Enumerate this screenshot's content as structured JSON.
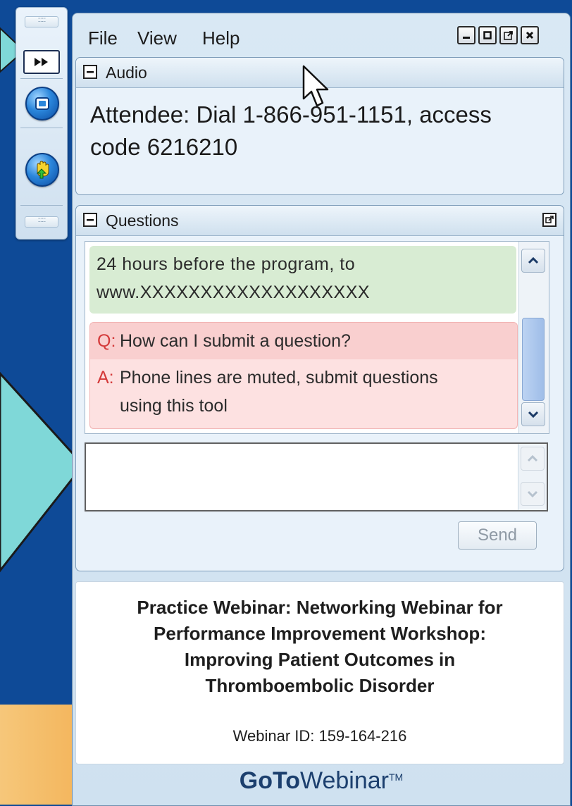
{
  "menu": {
    "file": "File",
    "view": "View",
    "help": "Help"
  },
  "window_controls": [
    "minimize",
    "restore",
    "pop-out",
    "close"
  ],
  "audio": {
    "title": "Audio",
    "line1": "Attendee: Dial 1-866-951-1151, access",
    "line2": "code 6216210"
  },
  "questions": {
    "title": "Questions",
    "answer_line1": "24 hours before the program, to",
    "answer_line2": "www.XXXXXXXXXXXXXXXXXXX",
    "q_prefix": "Q:",
    "q_text": "How can I submit a question?",
    "a_prefix": "A:",
    "a_line1": "Phone lines are muted, submit questions",
    "a_line2": "using this tool",
    "input_value": "",
    "send_label": "Send"
  },
  "webinar": {
    "title_line1": "Practice Webinar: Networking Webinar for",
    "title_line2": "Performance Improvement Workshop:",
    "title_line3": "Improving Patient Outcomes in",
    "title_line4": "Thromboembolic Disorder",
    "id_text": "Webinar ID: 159-164-216"
  },
  "brand": {
    "bold": "GoTo",
    "light": "Webinar",
    "tm": "TM"
  },
  "colors": {
    "background": "#0e4a97",
    "callout": "#7fd8d8",
    "panel": "#d9e8f4"
  }
}
